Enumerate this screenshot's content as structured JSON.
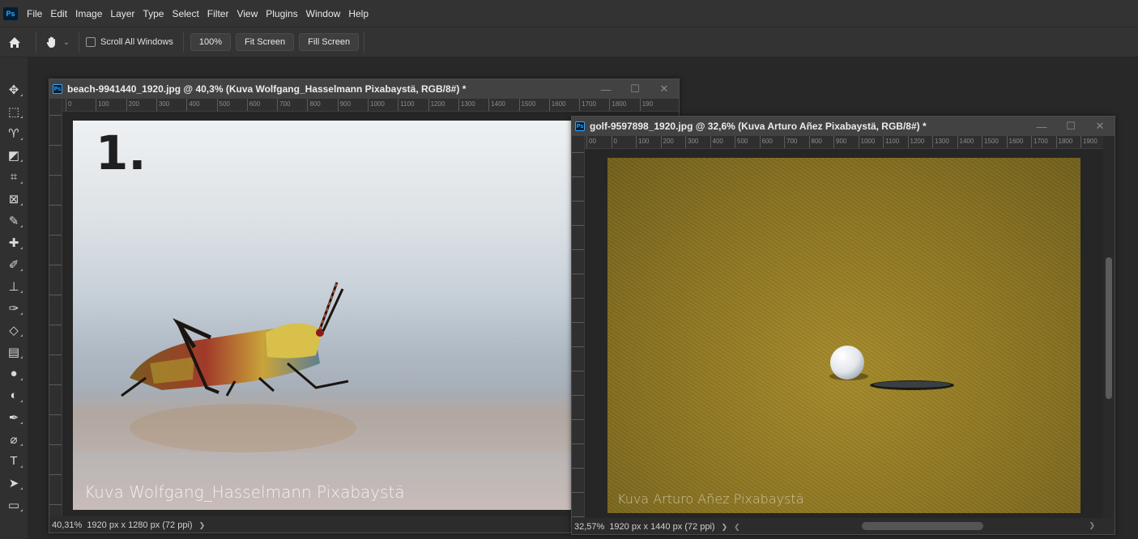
{
  "app": {
    "logo": "Ps",
    "menu": [
      "File",
      "Edit",
      "Image",
      "Layer",
      "Type",
      "Select",
      "Filter",
      "View",
      "Plugins",
      "Window",
      "Help"
    ]
  },
  "options_bar": {
    "home_icon": "home-icon",
    "hand_icon": "hand-tool-icon",
    "scroll_all_label": "Scroll All Windows",
    "scroll_all_checked": false,
    "btn_100": "100%",
    "btn_fit": "Fit Screen",
    "btn_fill": "Fill Screen"
  },
  "toolbar": {
    "tools": [
      {
        "name": "move-tool-icon",
        "glyph": "✥"
      },
      {
        "name": "marquee-tool-icon",
        "glyph": "⬚"
      },
      {
        "name": "lasso-tool-icon",
        "glyph": "♈"
      },
      {
        "name": "object-selection-tool-icon",
        "glyph": "◩"
      },
      {
        "name": "crop-tool-icon",
        "glyph": "⌗"
      },
      {
        "name": "frame-tool-icon",
        "glyph": "⊠"
      },
      {
        "name": "eyedropper-tool-icon",
        "glyph": "✎"
      },
      {
        "name": "healing-brush-tool-icon",
        "glyph": "✚"
      },
      {
        "name": "brush-tool-icon",
        "glyph": "✐"
      },
      {
        "name": "clone-stamp-tool-icon",
        "glyph": "⊥"
      },
      {
        "name": "history-brush-tool-icon",
        "glyph": "✑"
      },
      {
        "name": "eraser-tool-icon",
        "glyph": "◇"
      },
      {
        "name": "gradient-tool-icon",
        "glyph": "▤"
      },
      {
        "name": "blur-tool-icon",
        "glyph": "●"
      },
      {
        "name": "dodge-tool-icon",
        "glyph": "◐"
      },
      {
        "name": "pen-tool-icon",
        "glyph": "✒"
      },
      {
        "name": "pen-path-tool-icon",
        "glyph": "⌀"
      },
      {
        "name": "type-tool-icon",
        "glyph": "T"
      },
      {
        "name": "path-selection-tool-icon",
        "glyph": "➤"
      },
      {
        "name": "rectangle-tool-icon",
        "glyph": "▭"
      }
    ]
  },
  "doc1": {
    "title": "beach-9941440_1920.jpg @ 40,3% (Kuva Wolfgang_Hasselmann Pixabaystä, RGB/8#) *",
    "ruler_ticks": [
      "0",
      "100",
      "200",
      "300",
      "400",
      "500",
      "600",
      "700",
      "800",
      "900",
      "1000",
      "1100",
      "1200",
      "1300",
      "1400",
      "1500",
      "1600",
      "1700",
      "1800",
      "190"
    ],
    "overlay_number": "1.",
    "watermark": "Kuva Wolfgang_Hasselmann Pixabaystä",
    "zoom": "40,31%",
    "info": "1920 px x 1280 px (72 ppi)",
    "chevron": "❯"
  },
  "doc2": {
    "title": "golf-9597898_1920.jpg @ 32,6% (Kuva Arturo Añez Pixabaystä, RGB/8#) *",
    "ruler_ticks": [
      "00",
      "0",
      "100",
      "200",
      "300",
      "400",
      "500",
      "600",
      "700",
      "800",
      "900",
      "1000",
      "1100",
      "1200",
      "1300",
      "1400",
      "1500",
      "1600",
      "1700",
      "1800",
      "1900"
    ],
    "watermark": "Kuva Arturo Añez Pixabaystä",
    "zoom": "32,57%",
    "info": "1920 px x 1440 px (72 ppi)",
    "chevron": "❯",
    "left_arrow": "❮",
    "right_arrow": "❯"
  },
  "window_controls": {
    "minimize": "—",
    "maximize": "☐",
    "close": "✕"
  }
}
